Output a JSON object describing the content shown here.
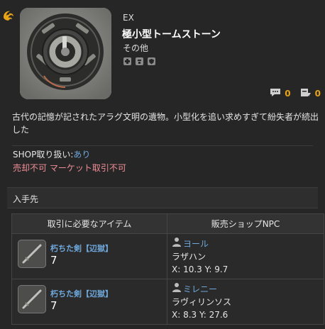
{
  "item": {
    "category": "EX",
    "name": "極小型トームストーン",
    "type": "その他",
    "description": "古代の記憶が記されたアラグ文明の遺物。小型化を追い求めすぎて紛失者が続出した"
  },
  "flags": [
    "unique-icon",
    "untradable-icon",
    "shield-icon"
  ],
  "counts": {
    "comments": "0",
    "reports": "0"
  },
  "shop": {
    "label": "SHOP取り扱い:",
    "value": "あり",
    "restrictions": "売却不可 マーケット取引不可"
  },
  "acquisition": {
    "header": "入手先",
    "columns": [
      "取引に必要なアイテム",
      "販売ショップNPC"
    ],
    "rows": [
      {
        "cost_item": "朽ちた剣【辺獄】",
        "quantity": "7",
        "npc": "ヨール",
        "zone": "ラザハン",
        "coords": "X: 10.3 Y: 9.7"
      },
      {
        "cost_item": "朽ちた剣【辺獄】",
        "quantity": "7",
        "npc": "ミレニー",
        "zone": "ラヴィリンソス",
        "coords": "X: 8.3 Y: 27.6"
      }
    ]
  },
  "colors": {
    "background": "#262626",
    "link": "#6fa8dc",
    "count": "#e8a317",
    "restriction": "#ef8d96",
    "ex_badge": "#e8a317"
  }
}
